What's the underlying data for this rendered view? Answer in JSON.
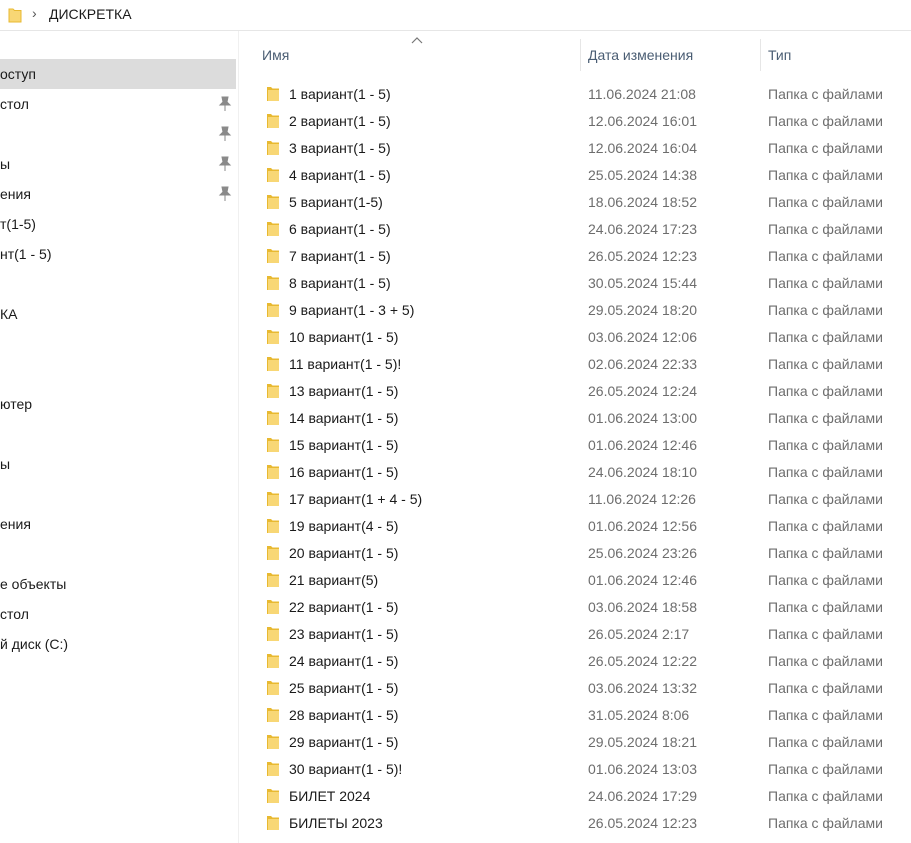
{
  "address": {
    "path": "ДИСКРЕТКА",
    "folder_icon": "folder-icon",
    "separator_icon": "chevron-right-icon"
  },
  "nav": {
    "items": [
      {
        "label": "оступ",
        "selected": true,
        "pinned": false
      },
      {
        "label": "стол",
        "selected": false,
        "pinned": true
      },
      {
        "label": "",
        "selected": false,
        "pinned": true
      },
      {
        "label": "ы",
        "selected": false,
        "pinned": true
      },
      {
        "label": "ения",
        "selected": false,
        "pinned": true
      },
      {
        "label": "т(1-5)",
        "selected": false,
        "pinned": false
      },
      {
        "label": "нт(1 - 5)",
        "selected": false,
        "pinned": false
      },
      {
        "label": "",
        "selected": false,
        "pinned": false
      },
      {
        "label": "КА",
        "selected": false,
        "pinned": false
      },
      {
        "label": "",
        "selected": false,
        "pinned": false
      },
      {
        "label": "",
        "selected": false,
        "pinned": false
      },
      {
        "label": "ютер",
        "selected": false,
        "pinned": false
      },
      {
        "label": "",
        "selected": false,
        "pinned": false
      },
      {
        "label": "ы",
        "selected": false,
        "pinned": false
      },
      {
        "label": "",
        "selected": false,
        "pinned": false
      },
      {
        "label": "ения",
        "selected": false,
        "pinned": false
      },
      {
        "label": "",
        "selected": false,
        "pinned": false
      },
      {
        "label": "е объекты",
        "selected": false,
        "pinned": false
      },
      {
        "label": "стол",
        "selected": false,
        "pinned": false
      },
      {
        "label": "й диск (C:)",
        "selected": false,
        "pinned": false
      }
    ]
  },
  "columns": {
    "name": "Имя",
    "date": "Дата изменения",
    "type": "Тип",
    "sort_icon": "sort-ascending-icon"
  },
  "files": [
    {
      "name": "1 вариант(1 - 5)",
      "date": "11.06.2024 21:08",
      "type": "Папка с файлами"
    },
    {
      "name": "2 вариант(1 - 5)",
      "date": "12.06.2024 16:01",
      "type": "Папка с файлами"
    },
    {
      "name": "3 вариант(1 - 5)",
      "date": "12.06.2024 16:04",
      "type": "Папка с файлами"
    },
    {
      "name": "4 вариант(1 - 5)",
      "date": "25.05.2024 14:38",
      "type": "Папка с файлами"
    },
    {
      "name": "5 вариант(1-5)",
      "date": "18.06.2024 18:52",
      "type": "Папка с файлами"
    },
    {
      "name": "6 вариант(1 - 5)",
      "date": "24.06.2024 17:23",
      "type": "Папка с файлами"
    },
    {
      "name": "7 вариант(1 - 5)",
      "date": "26.05.2024 12:23",
      "type": "Папка с файлами"
    },
    {
      "name": "8 вариант(1 - 5)",
      "date": "30.05.2024 15:44",
      "type": "Папка с файлами"
    },
    {
      "name": "9 вариант(1 - 3 + 5)",
      "date": "29.05.2024 18:20",
      "type": "Папка с файлами"
    },
    {
      "name": "10 вариант(1 - 5)",
      "date": "03.06.2024 12:06",
      "type": "Папка с файлами"
    },
    {
      "name": "11 вариант(1 - 5)!",
      "date": "02.06.2024 22:33",
      "type": "Папка с файлами"
    },
    {
      "name": "13 вариант(1 - 5)",
      "date": "26.05.2024 12:24",
      "type": "Папка с файлами"
    },
    {
      "name": "14 вариант(1 - 5)",
      "date": "01.06.2024 13:00",
      "type": "Папка с файлами"
    },
    {
      "name": "15 вариант(1 - 5)",
      "date": "01.06.2024 12:46",
      "type": "Папка с файлами"
    },
    {
      "name": "16 вариант(1 - 5)",
      "date": "24.06.2024 18:10",
      "type": "Папка с файлами"
    },
    {
      "name": "17 вариант(1 + 4 - 5)",
      "date": "11.06.2024 12:26",
      "type": "Папка с файлами"
    },
    {
      "name": "19 вариант(4 - 5)",
      "date": "01.06.2024 12:56",
      "type": "Папка с файлами"
    },
    {
      "name": "20 вариант(1 - 5)",
      "date": "25.06.2024 23:26",
      "type": "Папка с файлами"
    },
    {
      "name": "21 вариант(5)",
      "date": "01.06.2024 12:46",
      "type": "Папка с файлами"
    },
    {
      "name": "22 вариант(1 - 5)",
      "date": "03.06.2024 18:58",
      "type": "Папка с файлами"
    },
    {
      "name": "23 вариант(1 - 5)",
      "date": "26.05.2024 2:17",
      "type": "Папка с файлами"
    },
    {
      "name": "24 вариант(1 - 5)",
      "date": "26.05.2024 12:22",
      "type": "Папка с файлами"
    },
    {
      "name": "25 вариант(1 - 5)",
      "date": "03.06.2024 13:32",
      "type": "Папка с файлами"
    },
    {
      "name": "28 вариант(1 - 5)",
      "date": "31.05.2024 8:06",
      "type": "Папка с файлами"
    },
    {
      "name": "29 вариант(1 - 5)",
      "date": "29.05.2024 18:21",
      "type": "Папка с файлами"
    },
    {
      "name": "30 вариант(1 - 5)!",
      "date": "01.06.2024 13:03",
      "type": "Папка с файлами"
    },
    {
      "name": "БИЛЕТ 2024",
      "date": "24.06.2024 17:29",
      "type": "Папка с файлами"
    },
    {
      "name": "БИЛЕТЫ 2023",
      "date": "26.05.2024 12:23",
      "type": "Папка с файлами"
    }
  ],
  "colors": {
    "folder": "#f8d775",
    "folder_dark": "#e8b931",
    "header_text": "#4a5d73",
    "secondary_text": "#6d6d6d",
    "selected_nav": "#dcdcdc"
  }
}
